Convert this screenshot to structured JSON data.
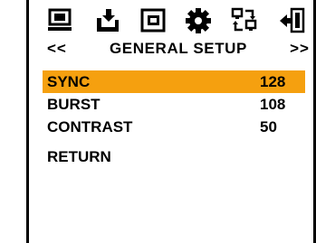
{
  "colors": {
    "accent": "#f5a00f",
    "icon": "#000000"
  },
  "icons": [
    "monitor-icon",
    "download-icon",
    "picture-in-picture-icon",
    "gear-icon",
    "network-icon",
    "exit-icon"
  ],
  "header": {
    "left": "<<",
    "title": "GENERAL SETUP",
    "right": ">>"
  },
  "menu": {
    "items": [
      {
        "label": "SYNC",
        "value": "128",
        "selected": true
      },
      {
        "label": "BURST",
        "value": "108",
        "selected": false
      },
      {
        "label": "CONTRAST",
        "value": "50",
        "selected": false
      }
    ],
    "return_label": "RETURN"
  }
}
